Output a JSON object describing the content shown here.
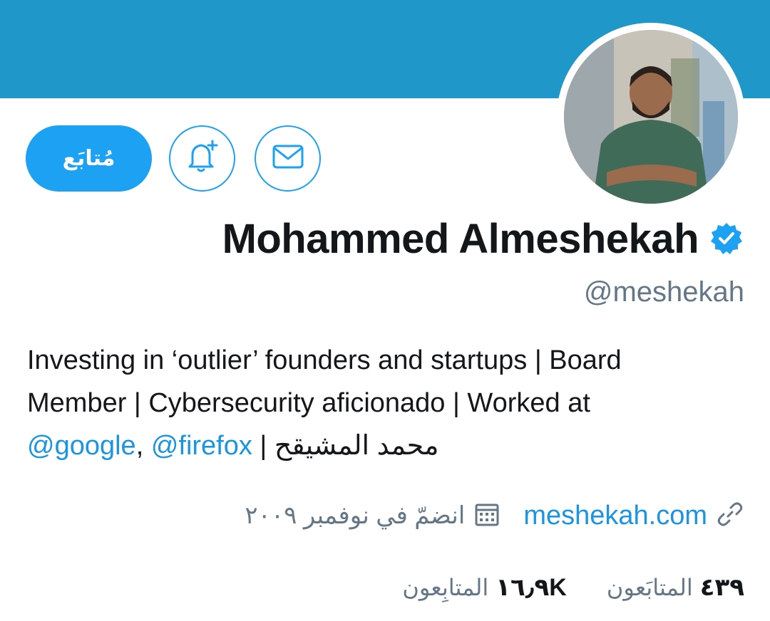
{
  "profile": {
    "name": "Mohammed Almeshekah",
    "handle": "@meshekah",
    "verified": true,
    "bio": {
      "line1": "Investing in ‘outlier’ founders and startups | Board",
      "line2": "Member | Cybersecurity aficionado | Worked at",
      "mention1": "@google",
      "separator": ",",
      "mention2": "@firefox",
      "tail": " | محمد المشيقح"
    },
    "website": "meshekah.com",
    "joined": "انضمّ في نوفمبر ٢٠٠٩"
  },
  "actions": {
    "follow_label": "مُتابَع"
  },
  "stats": {
    "following_count": "٤٣٩",
    "following_label": "المتابَعون",
    "followers_count": "١٦٫٩K",
    "followers_label": "المتابِعون"
  },
  "colors": {
    "banner": "#1f97c9",
    "accent": "#1da1f2",
    "link": "#1b95e0",
    "muted": "#657786",
    "text": "#14171a"
  },
  "icons": [
    "bell-plus-icon",
    "mail-icon",
    "verified-badge-icon",
    "link-icon",
    "calendar-icon"
  ]
}
